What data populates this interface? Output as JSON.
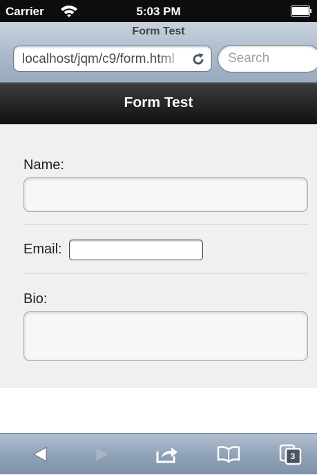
{
  "status_bar": {
    "carrier": "Carrier",
    "time": "5:03 PM",
    "icons": [
      "wifi-icon",
      "battery-icon"
    ]
  },
  "browser": {
    "page_title": "Form Test",
    "url": "localhost/jqm/c9/form.html",
    "search_placeholder": "Search",
    "icons": [
      "reload-icon"
    ]
  },
  "header": {
    "title": "Form Test"
  },
  "form": {
    "name_label": "Name:",
    "name_value": "",
    "email_label": "Email:",
    "email_value": "",
    "bio_label": "Bio:",
    "bio_value": ""
  },
  "toolbar": {
    "icons": [
      "back-arrow-icon",
      "forward-arrow-icon",
      "share-icon",
      "bookmarks-icon",
      "tabs-icon"
    ],
    "tabs_count": "3"
  },
  "colors": {
    "header_bg": "#1a1a1a",
    "chrome_blue": "#a8b6c8",
    "content_bg": "#f0f0f0"
  }
}
